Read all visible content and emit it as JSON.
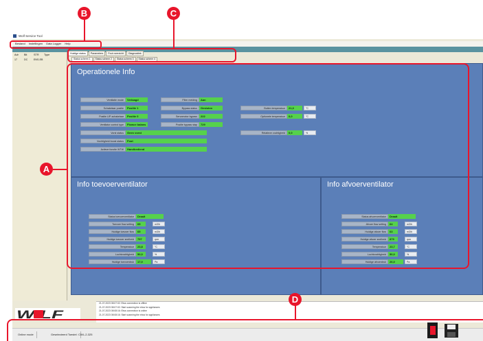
{
  "window": {
    "title": "Wolf Service Tool"
  },
  "menu": {
    "items": [
      "Bestand",
      "Instellingen",
      "Data Logger",
      "Help"
    ]
  },
  "left_panel": {
    "columns": [
      "Adr",
      "Bit",
      "STR",
      "Type"
    ],
    "row": [
      "17",
      "DC",
      "ENS-EB"
    ]
  },
  "tabs": {
    "main": [
      "Huidige status",
      "Parameters",
      "Fout overzicht",
      "Diagnostiek"
    ],
    "sub": [
      "Status scherm 1",
      "Status scherm 2",
      "Status scherm 3",
      "Status scherm 4"
    ]
  },
  "operationele_info": {
    "title": "Operationele Info",
    "col1": [
      {
        "label": "Ventilatie mode",
        "value": "Verlaagd"
      },
      {
        "label": "Schakelaar positie",
        "value": "Positie 1"
      },
      {
        "label": "Positie LIP-schakelaar",
        "value": "Positie 0"
      },
      {
        "label": "Ventilator control type",
        "value": "Flowce balans"
      },
      {
        "label": "Vorst status",
        "value": "Geen vorst"
      },
      {
        "label": "Vochtigheid boost status",
        "value": "Fout"
      },
      {
        "label": "Actieve functie WTW",
        "value": "Handbediend"
      }
    ],
    "col2": [
      {
        "label": "Filter melding",
        "value": "Aan"
      },
      {
        "label": "Bypass status",
        "value": "Gesloten"
      },
      {
        "label": "Servomotor bypass",
        "value": "222"
      },
      {
        "label": "Positie bypass stap",
        "value": "729"
      }
    ],
    "col3": [
      {
        "label": "Buiten temperatuur",
        "value": "21,3",
        "unit": "°C"
      },
      {
        "label": "Optionele temperatuur",
        "value": "0,0",
        "unit": "°C"
      },
      {
        "label": "Relatieve vochtigheid",
        "value": "0,0",
        "unit": "%"
      }
    ]
  },
  "toevoer": {
    "title": "Info toevoerventilator",
    "rows": [
      {
        "label": "Status toevoerventilator",
        "value": "Draait",
        "unit": ""
      },
      {
        "label": "Toevoer flow setting",
        "value": "65",
        "unit": "m3/h"
      },
      {
        "label": "Huidige toevoer flow",
        "value": "65",
        "unit": "m3/h"
      },
      {
        "label": "Huidige toevoer snelheid",
        "value": "797",
        "unit": "rpm"
      },
      {
        "label": "Temperatuur",
        "value": "23,8",
        "unit": "°C"
      },
      {
        "label": "Luchtvochtigheid",
        "value": "50,0",
        "unit": "%"
      },
      {
        "label": "Huidige toevoerdruk",
        "value": "17,0",
        "unit": "Pa"
      }
    ]
  },
  "afvoer": {
    "title": "Info afvoerventilator",
    "rows": [
      {
        "label": "Status afvoerventilator",
        "value": "Draait",
        "unit": ""
      },
      {
        "label": "Afvoer flow setting",
        "value": "64",
        "unit": "m3/h"
      },
      {
        "label": "Huidige afvoer flow",
        "value": "63",
        "unit": "m3/h"
      },
      {
        "label": "Huidige afvoer snelheid",
        "value": "879",
        "unit": "rpm"
      },
      {
        "label": "Temperatuur",
        "value": "23,7",
        "unit": "°C"
      },
      {
        "label": "Luchtvochtigheid",
        "value": "50,0",
        "unit": "%"
      },
      {
        "label": "Huidige afvoerdruk",
        "value": "26,0",
        "unit": "Pa"
      }
    ]
  },
  "log": {
    "lines": [
      "21-07-2023 08:07:02: Ebus connection is offline",
      "21-07-2023 08:07:02: Start scanning the ebus for appliances",
      "21-07-2023 08:08:16: Ebus connection is online",
      "21-07-2023 08:08:16: Start scanning the ebus for appliances"
    ]
  },
  "logo": {
    "text": "WOLF"
  },
  "statusbar": {
    "mode": "Online mode",
    "device": "Geselecteerd Toestel:",
    "device_value": "CWL-2-325"
  },
  "annotations": {
    "a": "A",
    "b": "B",
    "c": "C",
    "d": "D"
  },
  "colors": {
    "panel": "#5b7fb8",
    "value_green": "#56d14c",
    "annotation_red": "#e8152b"
  }
}
